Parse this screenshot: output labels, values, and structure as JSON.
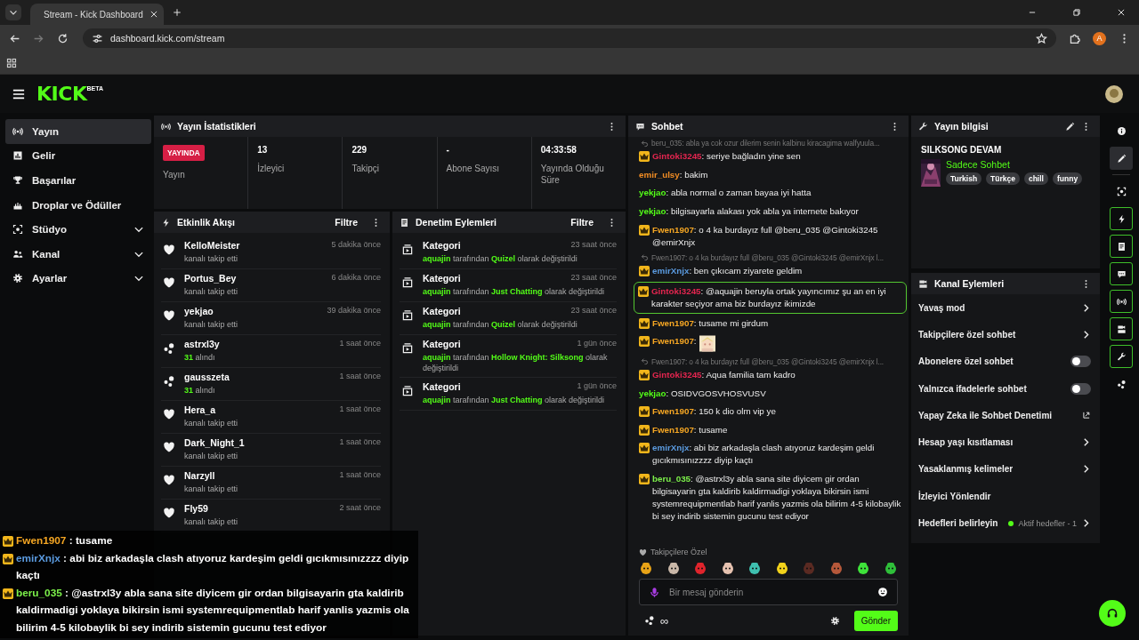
{
  "browser": {
    "tab_title": "Stream - Kick Dashboard",
    "url": "dashboard.kick.com/stream",
    "profile_initial": "A"
  },
  "header": {
    "logo": "KICK",
    "logo_badge": "BETA"
  },
  "sidebar": {
    "items": [
      {
        "label": "Yayın",
        "selected": true,
        "expandable": false
      },
      {
        "label": "Gelir",
        "selected": false,
        "expandable": false
      },
      {
        "label": "Başarılar",
        "selected": false,
        "expandable": false
      },
      {
        "label": "Droplar ve Ödüller",
        "selected": false,
        "expandable": false
      },
      {
        "label": "Stüdyo",
        "selected": false,
        "expandable": true
      },
      {
        "label": "Kanal",
        "selected": false,
        "expandable": true
      },
      {
        "label": "Ayarlar",
        "selected": false,
        "expandable": true
      }
    ]
  },
  "stats": {
    "title": "Yayın İstatistikleri",
    "status": {
      "label": "YAYINDA",
      "caption": "Yayın",
      "live": true
    },
    "items": [
      {
        "value": "13",
        "label": "İzleyici"
      },
      {
        "value": "229",
        "label": "Takipçi"
      },
      {
        "value": "-",
        "label": "Abone Sayısı"
      },
      {
        "value": "04:33:58",
        "label": "Yayında Olduğu Süre"
      }
    ]
  },
  "activity": {
    "title": "Etkinlik Akışı",
    "filter": "Filtre",
    "items": [
      {
        "kind": "follow",
        "name": "KelloMeister",
        "time": "5 dakika önce",
        "detail": "kanalı takip etti"
      },
      {
        "kind": "follow",
        "name": "Portus_Bey",
        "time": "6 dakika önce",
        "detail": "kanalı takip etti"
      },
      {
        "kind": "follow",
        "name": "yekjao",
        "time": "39 dakika önce",
        "detail": "kanalı takip etti"
      },
      {
        "kind": "points",
        "name": "astrxl3y",
        "time": "1 saat önce",
        "amount": "31",
        "detail": "alındı"
      },
      {
        "kind": "points",
        "name": "gausszeta",
        "time": "1 saat önce",
        "amount": "31",
        "detail": "alındı"
      },
      {
        "kind": "follow",
        "name": "Hera_a",
        "time": "1 saat önce",
        "detail": "kanalı takip etti"
      },
      {
        "kind": "follow",
        "name": "Dark_Night_1",
        "time": "1 saat önce",
        "detail": "kanalı takip etti"
      },
      {
        "kind": "follow",
        "name": "Narzyll",
        "time": "1 saat önce",
        "detail": "kanalı takip etti"
      },
      {
        "kind": "follow",
        "name": "Fly59",
        "time": "2 saat önce",
        "detail": "kanalı takip etti"
      }
    ]
  },
  "moderation": {
    "title": "Denetim Eylemleri",
    "filter": "Filtre",
    "items": [
      {
        "title": "Kategori",
        "time": "23 saat önce",
        "parts": [
          {
            "text": "aquajin",
            "highlight": true
          },
          {
            "text": "tarafından",
            "highlight": false
          },
          {
            "text": "Quizel",
            "highlight": true
          },
          {
            "text": "olarak değiştirildi",
            "highlight": false
          }
        ]
      },
      {
        "title": "Kategori",
        "time": "23 saat önce",
        "parts": [
          {
            "text": "aquajin",
            "highlight": true
          },
          {
            "text": "tarafından",
            "highlight": false
          },
          {
            "text": "Just Chatting",
            "highlight": true
          },
          {
            "text": "olarak değiştirildi",
            "highlight": false
          }
        ]
      },
      {
        "title": "Kategori",
        "time": "23 saat önce",
        "parts": [
          {
            "text": "aquajin",
            "highlight": true
          },
          {
            "text": "tarafından",
            "highlight": false
          },
          {
            "text": "Quizel",
            "highlight": true
          },
          {
            "text": "olarak değiştirildi",
            "highlight": false
          }
        ]
      },
      {
        "title": "Kategori",
        "time": "1 gün önce",
        "parts": [
          {
            "text": "aquajin",
            "highlight": true
          },
          {
            "text": "tarafından",
            "highlight": false
          },
          {
            "text": "Hollow Knight: Silksong",
            "highlight": true
          },
          {
            "text": "olarak değiştirildi",
            "highlight": false
          }
        ]
      },
      {
        "title": "Kategori",
        "time": "1 gün önce",
        "parts": [
          {
            "text": "aquajin",
            "highlight": true
          },
          {
            "text": "tarafından",
            "highlight": false
          },
          {
            "text": "Just Chatting",
            "highlight": true
          },
          {
            "text": "olarak değiştirildi",
            "highlight": false
          }
        ]
      }
    ]
  },
  "chat": {
    "title": "Sohbet",
    "messages": [
      {
        "kind": "reply",
        "text": "beru_035: abla ya cok ozur dilerim senin kalbinu kiracagima walfyuula..."
      },
      {
        "kind": "text",
        "user": "Gintoki3245",
        "color": "#e3254f",
        "badge": true,
        "highlighted": false,
        "text": ": seriye bağladın yine sen"
      },
      {
        "kind": "text",
        "user": "emir_ulsy",
        "color": "#f08c24",
        "badge": false,
        "highlighted": false,
        "text": ": bakim"
      },
      {
        "kind": "text",
        "user": "yekjao",
        "color": "#53fc18",
        "badge": false,
        "highlighted": false,
        "text": ": abla normal o zaman bayaa iyi hatta"
      },
      {
        "kind": "text",
        "user": "yekjao",
        "color": "#53fc18",
        "badge": false,
        "highlighted": false,
        "text": ": bilgisayarla alakası yok abla ya internete bakıyor"
      },
      {
        "kind": "text",
        "user": "Fwen1907",
        "color": "#f5a623",
        "badge": true,
        "highlighted": false,
        "text": ": o 4 ka burdayız full @beru_035 @Gintoki3245 @emirXnjx"
      },
      {
        "kind": "reply",
        "text": "Fwen1907: o 4 ka burdayız full @beru_035 @Gintoki3245 @emirXnjx l..."
      },
      {
        "kind": "text",
        "user": "emirXnjx",
        "color": "#5b9be0",
        "badge": true,
        "highlighted": false,
        "text": ": ben çıkıcam ziyarete geldim"
      },
      {
        "kind": "text",
        "user": "Gintoki3245",
        "color": "#e3254f",
        "badge": true,
        "highlighted": true,
        "text": ": @aquajin beruyla ortak yayıncımız şu an en iyi karakter seçiyor ama biz burdayız ikimizde"
      },
      {
        "kind": "text",
        "user": "Fwen1907",
        "color": "#f5a623",
        "badge": true,
        "highlighted": false,
        "text": ": tusame mi girdum"
      },
      {
        "kind": "emote",
        "user": "Fwen1907",
        "color": "#f5a623",
        "badge": true,
        "text": ":"
      },
      {
        "kind": "reply",
        "text": "Fwen1907: o 4 ka burdayız full @beru_035 @Gintoki3245 @emirXnjx l..."
      },
      {
        "kind": "text",
        "user": "Gintoki3245",
        "color": "#e3254f",
        "badge": true,
        "highlighted": false,
        "text": ": Aqua familia tam kadro"
      },
      {
        "kind": "text",
        "user": "yekjao",
        "color": "#53fc18",
        "badge": false,
        "highlighted": false,
        "text": ": OSIDVGOSVHOSVUSV"
      },
      {
        "kind": "text",
        "user": "Fwen1907",
        "color": "#f5a623",
        "badge": true,
        "highlighted": false,
        "text": ": 150 k dio olm vip ye"
      },
      {
        "kind": "text",
        "user": "Fwen1907",
        "color": "#f5a623",
        "badge": true,
        "highlighted": false,
        "text": ": tusame"
      },
      {
        "kind": "text",
        "user": "emirXnjx",
        "color": "#5b9be0",
        "badge": true,
        "highlighted": false,
        "text": ": abi biz arkadaşla clash atıyoruz kardeşim geldi gıcıkmısınızzzz diyip kaçtı"
      },
      {
        "kind": "text",
        "user": "beru_035",
        "color": "#7cf04a",
        "badge": true,
        "highlighted": false,
        "text": ": @astrxl3y abla sana site diyicem gir ordan bilgisayarin gta kaldirib kaldirmadigi yoklaya bikirsin ismi systemrequipmentlab harif yanlis yazmis ola bilirim 4-5 kilobaylik bi sey indirib sistemin gucunu test ediyor"
      }
    ],
    "emote_heading": "Takipçilere Özel",
    "emotes": [
      {
        "color": "#e8a317"
      },
      {
        "color": "#c9b7a8"
      },
      {
        "color": "#e0242c"
      },
      {
        "color": "#e6c2b0"
      },
      {
        "color": "#3fc0b0"
      },
      {
        "color": "#f2d21b"
      },
      {
        "color": "#5a2a22"
      },
      {
        "color": "#b5583a"
      },
      {
        "color": "#3ee23a"
      },
      {
        "color": "#2fbf3a"
      }
    ],
    "placeholder": "Bir mesaj gönderin",
    "points": "∞",
    "send": "Gönder"
  },
  "stream_info": {
    "title_label": "Yayın bilgisi",
    "title": "SILKSONG DEVAM",
    "category": "Sadece Sohbet",
    "tags": [
      "Turkish",
      "Türkçe",
      "chill",
      "funny"
    ]
  },
  "channel_actions": {
    "title": "Kanal Eylemleri",
    "items": [
      {
        "kind": "link",
        "label": "Yavaş mod"
      },
      {
        "kind": "link",
        "label": "Takipçilere özel sohbet"
      },
      {
        "kind": "toggle",
        "label": "Abonelere özel sohbet",
        "on": false
      },
      {
        "kind": "toggle",
        "label": "Yalnızca ifadelerle sohbet",
        "on": false
      },
      {
        "kind": "external",
        "label": "Yapay Zeka ile Sohbet Denetimi"
      },
      {
        "kind": "link",
        "label": "Hesap yaşı kısıtlaması"
      },
      {
        "kind": "link",
        "label": "Yasaklanmış kelimeler"
      },
      {
        "kind": "plain",
        "label": "İzleyici Yönlendir"
      },
      {
        "kind": "goal",
        "label": "Hedefleri belirleyin",
        "status": "Aktif hedefler - 1"
      }
    ]
  },
  "rail": [
    {
      "kind": "info",
      "selected": false,
      "open": false
    },
    {
      "kind": "edit",
      "selected": true,
      "open": false
    },
    {
      "kind": "capture",
      "selected": false,
      "open": false
    },
    {
      "kind": "bolt",
      "selected": false,
      "open": true
    },
    {
      "kind": "doc",
      "selected": false,
      "open": true
    },
    {
      "kind": "chat",
      "selected": false,
      "open": true
    },
    {
      "kind": "broadcast",
      "selected": false,
      "open": true
    },
    {
      "kind": "camera",
      "selected": false,
      "open": true
    },
    {
      "kind": "wrench",
      "selected": false,
      "open": true
    },
    {
      "kind": "points",
      "selected": false,
      "open": false
    }
  ],
  "overlay": [
    {
      "user": "Fwen1907",
      "color": "#f5a623",
      "text": " : tusame"
    },
    {
      "user": "emirXnjx",
      "color": "#5b9be0",
      "text": " : abi biz arkadaşla clash atıyoruz kardeşim geldi gıcıkmısınızzzz diyip kaçtı"
    },
    {
      "user": "beru_035",
      "color": "#7cf04a",
      "text": " : @astrxl3y abla sana site diyicem gir ordan bilgisayarin gta kaldirib kaldirmadigi yoklaya bikirsin ismi systemrequipmentlab harif yanlis yazmis ola bilirim 4-5 kilobaylik bi sey indirib sistemin gucunu test ediyor"
    }
  ]
}
